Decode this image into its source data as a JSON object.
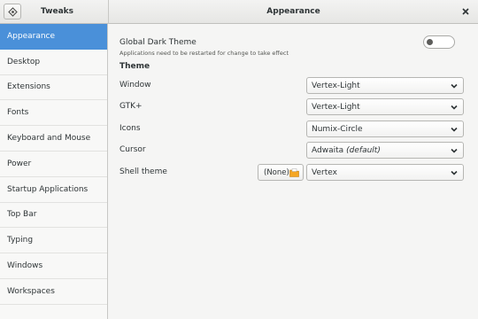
{
  "header": {
    "app_title": "Tweaks",
    "panel_title": "Appearance",
    "menu_icon": "gear-menu-icon",
    "close_icon": "close-icon"
  },
  "sidebar": {
    "items": [
      {
        "label": "Appearance",
        "active": true
      },
      {
        "label": "Desktop"
      },
      {
        "label": "Extensions"
      },
      {
        "label": "Fonts"
      },
      {
        "label": "Keyboard and Mouse"
      },
      {
        "label": "Power"
      },
      {
        "label": "Startup Applications"
      },
      {
        "label": "Top Bar"
      },
      {
        "label": "Typing"
      },
      {
        "label": "Windows"
      },
      {
        "label": "Workspaces"
      }
    ]
  },
  "main": {
    "dark_theme": {
      "label": "Global Dark Theme",
      "note": "Applications need to be restarted for change to take effect",
      "enabled": false
    },
    "theme_heading": "Theme",
    "rows": {
      "window": {
        "label": "Window",
        "value": "Vertex-Light"
      },
      "gtk": {
        "label": "GTK+",
        "value": "Vertex-Light"
      },
      "icons": {
        "label": "Icons",
        "value": "Numix-Circle"
      },
      "cursor": {
        "label": "Cursor",
        "value": "Adwaita",
        "value_suffix": "(default)"
      },
      "shell": {
        "label": "Shell theme",
        "file_button": "(None)",
        "value": "Vertex"
      }
    }
  },
  "colors": {
    "accent": "#4a90d9",
    "folder": "#f5a623"
  }
}
